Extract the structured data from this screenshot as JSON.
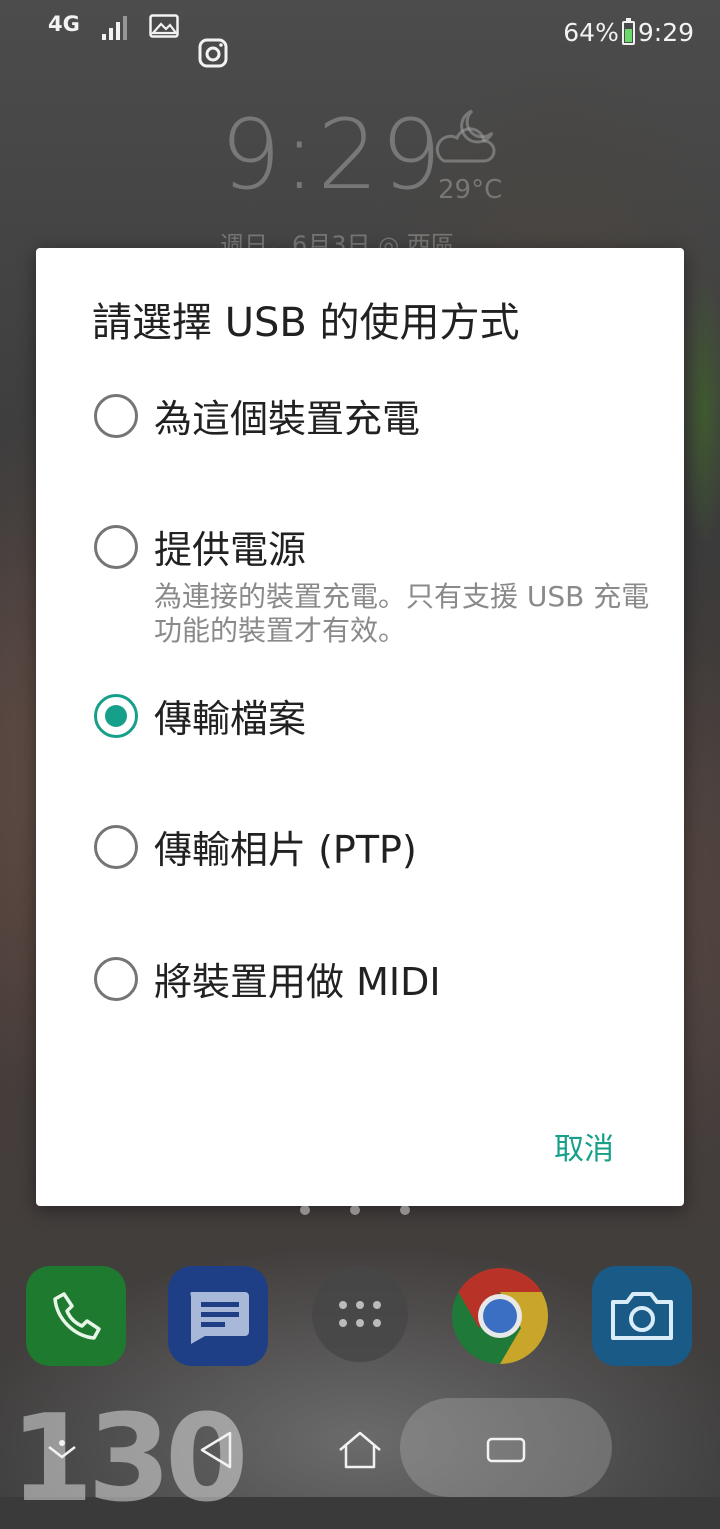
{
  "status_bar": {
    "network": "4G",
    "battery_percent": "64%",
    "time": "9:29"
  },
  "clock_widget": {
    "time": "9:29",
    "temperature": "29°C",
    "date_location": "週日，6月3日  ◎ 西區"
  },
  "dialog": {
    "title": "請選擇 USB 的使用方式",
    "options": [
      {
        "label": "為這個裝置充電",
        "checked": false
      },
      {
        "label": "提供電源",
        "checked": false,
        "description": "為連接的裝置充電。只有支援 USB 充電功能的裝置才有效。"
      },
      {
        "label": "傳輸檔案",
        "checked": true
      },
      {
        "label": "傳輸相片 (PTP)",
        "checked": false
      },
      {
        "label": "將裝置用做 MIDI",
        "checked": false
      }
    ],
    "cancel_label": "取消"
  },
  "wallpaper_text": "130",
  "dock": {
    "icons": [
      "phone-icon",
      "messages-icon",
      "app-drawer-icon",
      "chrome-icon",
      "camera-icon"
    ]
  },
  "navbar": {
    "icons": [
      "notification-pull-icon",
      "back-icon",
      "home-icon",
      "recents-icon"
    ]
  },
  "colors": {
    "accent": "#16a08a",
    "radio_unchecked": "#757575",
    "description": "#8a8a8a"
  }
}
